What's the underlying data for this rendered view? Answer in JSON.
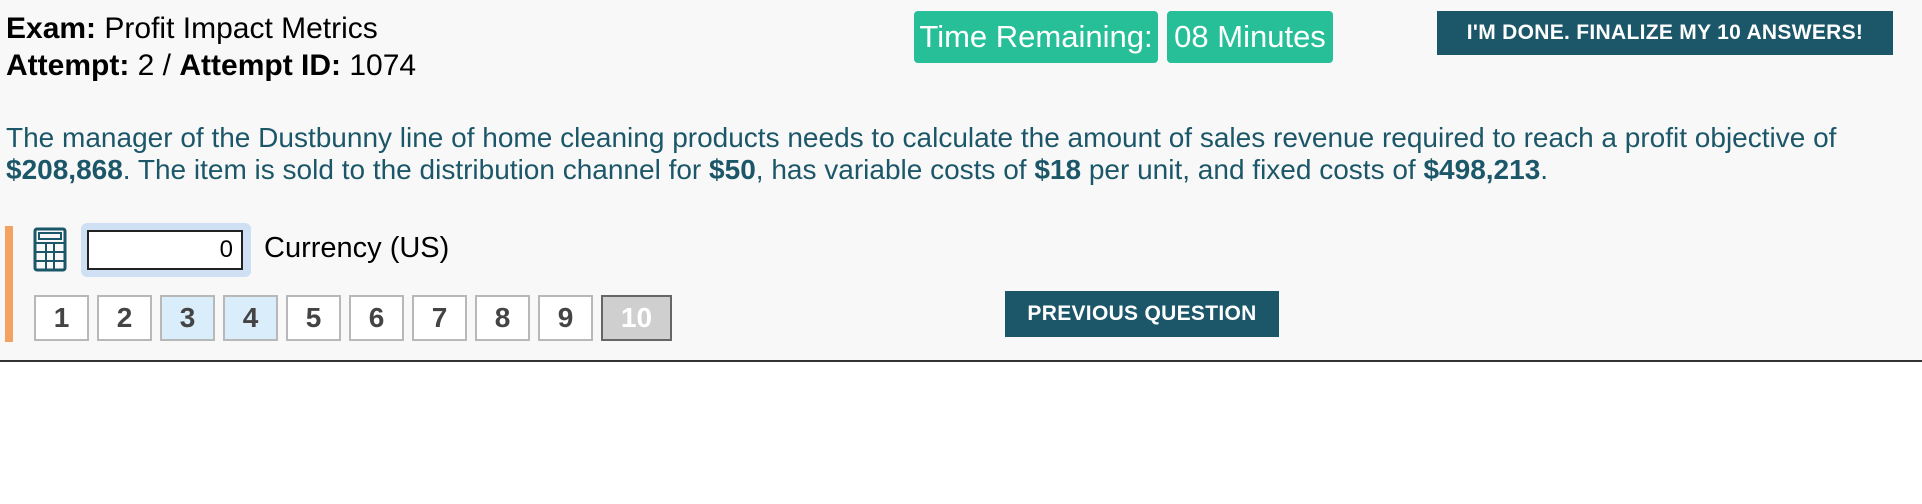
{
  "exam": {
    "exam_label": "Exam:",
    "exam_name": "Profit Impact Metrics",
    "attempt_label": "Attempt:",
    "attempt_value": "2",
    "separator": " / ",
    "attempt_id_label": "Attempt ID:",
    "attempt_id_value": "1074"
  },
  "timer": {
    "label": "Time Remaining:",
    "value": "08 Minutes",
    "color": "#26bf97"
  },
  "finalize_button": "I'M DONE. FINALIZE MY 10 ANSWERS!",
  "question": {
    "t1": "The manager of the Dustbunny line of home cleaning products needs to calculate the amount of sales revenue required to reach a profit objective of ",
    "profit": "$208,868",
    "t2": ". The item is sold to the distribution channel for ",
    "price": "$50",
    "t3": ", has variable costs of ",
    "variable": "$18",
    "t4": " per unit, and fixed costs of ",
    "fixed": "$498,213",
    "t5": ".",
    "color": "#1c5769"
  },
  "answer": {
    "value": "0",
    "unit_label": "Currency (US)",
    "icon": "calculator-icon"
  },
  "question_nav": [
    {
      "label": "1",
      "state": "default"
    },
    {
      "label": "2",
      "state": "default"
    },
    {
      "label": "3",
      "state": "answered"
    },
    {
      "label": "4",
      "state": "answered"
    },
    {
      "label": "5",
      "state": "default"
    },
    {
      "label": "6",
      "state": "default"
    },
    {
      "label": "7",
      "state": "default"
    },
    {
      "label": "8",
      "state": "default"
    },
    {
      "label": "9",
      "state": "default"
    },
    {
      "label": "10",
      "state": "current"
    }
  ],
  "previous_button": "PREVIOUS QUESTION",
  "colors": {
    "primary": "#1c5769",
    "accent": "#f4a261",
    "answered": "#d9eefa"
  }
}
